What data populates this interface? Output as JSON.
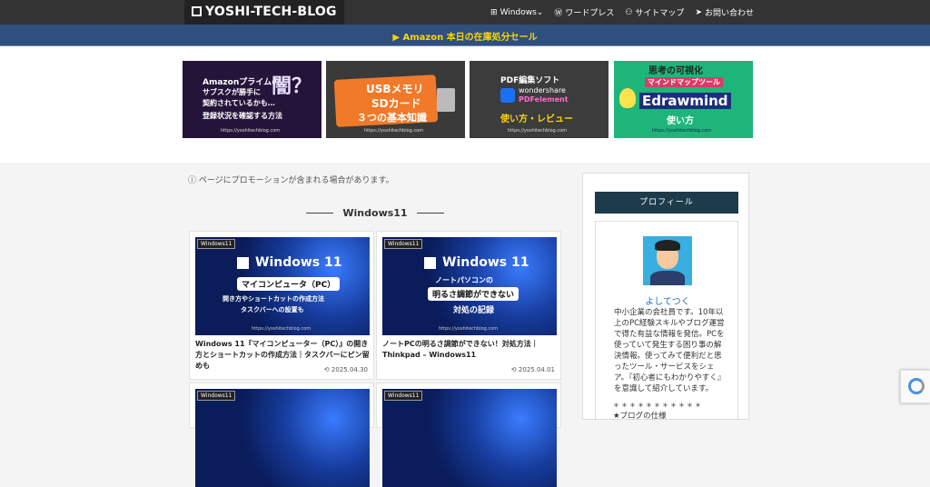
{
  "header": {
    "logo": "YOSHI-TECH-BLOG",
    "nav": [
      {
        "icon": "windows-icon",
        "glyph": "⊞",
        "label": "Windows⌄"
      },
      {
        "icon": "wordpress-icon",
        "glyph": "Ⓦ",
        "label": "ワードプレス"
      },
      {
        "icon": "sitemap-icon",
        "glyph": "⚇",
        "label": "サイトマップ"
      },
      {
        "icon": "paper-plane-icon",
        "glyph": "➤",
        "label": "お問い合わせ"
      }
    ]
  },
  "promo": {
    "text": "▶ Amazon 本日の在庫処分セール"
  },
  "banners": [
    {
      "lines": [
        "Amazonプライムの",
        "サブスクが勝手に",
        "契約されているかも…",
        "登録状況を確認する方法"
      ],
      "accent": "闇？",
      "url": "https://yoshitechblog.com"
    },
    {
      "lines": [
        "USBメモリ",
        "SDカード",
        "３つの基本知識"
      ],
      "url": "https://yoshitechblog.com"
    },
    {
      "lines": [
        "PDF編集ソフト",
        "wondershare",
        "PDFelement",
        "使い方・レビュー"
      ],
      "url": "https://yoshitechblog.com"
    },
    {
      "lines": [
        "思考の可視化",
        "マインドマップツール",
        "Edrawmind",
        "使い方"
      ],
      "url": "https://yoshitechblog.com"
    }
  ],
  "notice": "ⓘ ページにプロモーションが含まれる場合があります。",
  "section_title": "Windows11",
  "cards": [
    {
      "tag": "Windows11",
      "thumb_title": "Windows 11",
      "thumb_lines": [
        "マイコンピュータ（PC）",
        "開き方やショートカットの作成方法",
        "タスクバーへの設置も"
      ],
      "title": "Windows 11『マイコンピューター（PC）』の開き方とショートカットの作成方法｜タスクバーにピン留めも",
      "date": "2025.04.30"
    },
    {
      "tag": "Windows11",
      "thumb_title": "Windows 11",
      "thumb_lines": [
        "ノートパソコンの",
        "明るさ調節ができない",
        "対処の記録"
      ],
      "title": "ノートPCの明るさ調節ができない！対処方法｜Thinkpad – Windows11",
      "date": "2025.04.01"
    },
    {
      "tag": "Windows11"
    },
    {
      "tag": "Windows11"
    }
  ],
  "sidebar": {
    "heading": "プロフィール",
    "name": "よしてつく",
    "bio": "中小企業の会社員です。10年以上のPC経験スキルやブログ運営で得た有益な情報を発信。PCを使っていて発生する困り事の解決情報。使ってみて便利だと思ったツール・サービスをシェア。『初心者にもわかりやすく』を意識して紹介しています。",
    "stars": "＊＊＊＊＊＊＊＊＊＊＊",
    "list_item": "★ブログの仕様"
  },
  "colors": {
    "header": "#333333",
    "promo_bg": "#2f4f7f",
    "promo_text": "#ffd400",
    "profile_head": "#1d3b4a",
    "name_link": "#1d70c8"
  }
}
